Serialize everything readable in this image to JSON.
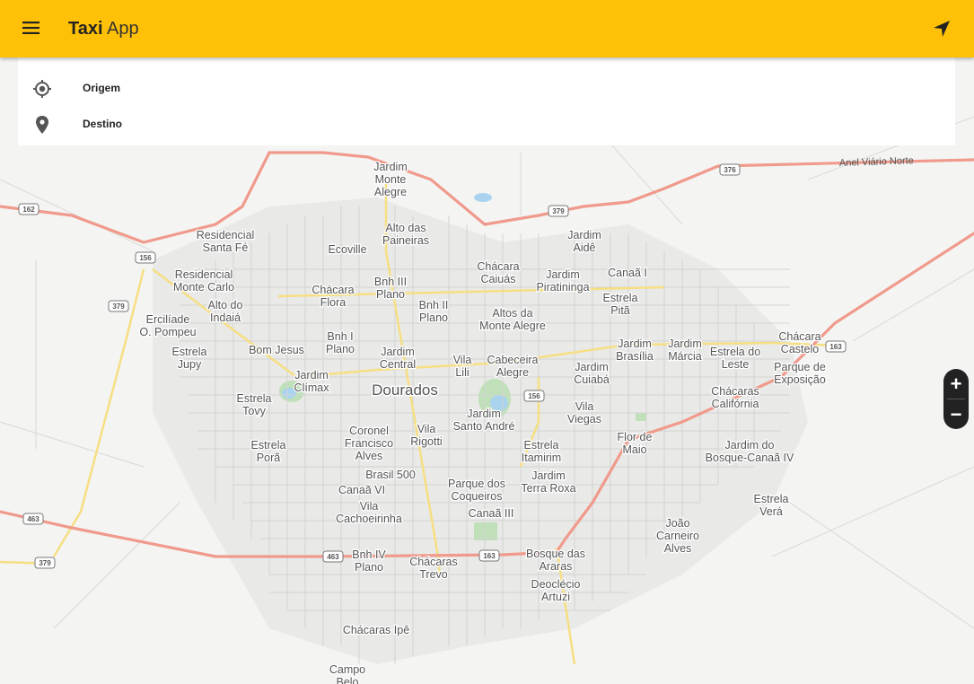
{
  "app": {
    "title_bold": "Taxi",
    "title_light": "App"
  },
  "icons": {
    "menu": "menu-icon",
    "navigate": "navigation-arrow-icon",
    "origin": "gps-crosshair-icon",
    "destination": "map-pin-icon"
  },
  "route": {
    "origin_label": "Origem",
    "destination_label": "Destino"
  },
  "zoom": {
    "in": "+",
    "out": "−"
  },
  "colors": {
    "appbar": "#ffc107",
    "major_road": "#f09a8c",
    "minor_road": "#f6df82"
  },
  "map_labels": {
    "city": "Dourados",
    "districts": [
      [
        "Jardim",
        "Monte",
        "Alegre"
      ],
      [
        "Alto das",
        "Paineiras"
      ],
      [
        "Ecoville"
      ],
      [
        "Residencial",
        "Santa Fé"
      ],
      [
        "Residencial",
        "Monte Carlo"
      ],
      [
        "Alto do",
        "Indaiá"
      ],
      [
        "Ercilíade",
        "O. Pompeu"
      ],
      [
        "Estrela",
        "Jupy"
      ],
      [
        "Chácara",
        "Flora"
      ],
      [
        "Bnh III",
        "Plano"
      ],
      [
        "Bnh II",
        "Plano"
      ],
      [
        "Chácara",
        "Caiuás"
      ],
      [
        "Jardim",
        "Aidê"
      ],
      [
        "Jardim",
        "Piratininga"
      ],
      [
        "Canaã I"
      ],
      [
        "Estrela",
        "Pitã"
      ],
      [
        "Altos da",
        "Monte Alegre"
      ],
      [
        "Bom Jesus"
      ],
      [
        "Bnh I",
        "Plano"
      ],
      [
        "Jardim",
        "Central"
      ],
      [
        "Vila",
        "Lili"
      ],
      [
        "Cabeceira",
        "Alegre"
      ],
      [
        "Jardim",
        "Brasília"
      ],
      [
        "Jardim",
        "Márcia"
      ],
      [
        "Estrela do",
        "Leste"
      ],
      [
        "Chácara",
        "Castelo"
      ],
      [
        "Parque de",
        "Exposição"
      ],
      [
        "Jardim",
        "Clímax"
      ],
      [
        "Estrela",
        "Tovy"
      ],
      [
        "Jardim",
        "Cuiabá"
      ],
      [
        "Chácaras",
        "Califórnia"
      ],
      [
        "Jardim",
        "Santo André"
      ],
      [
        "Vila",
        "Viegas"
      ],
      [
        "Coronel",
        "Francisco",
        "Alves"
      ],
      [
        "Vila",
        "Rigotti"
      ],
      [
        "Estrela",
        "Porã"
      ],
      [
        "Flor de",
        "Maio"
      ],
      [
        "Jardim do",
        "Bosque-Canaã IV"
      ],
      [
        "Estrela",
        "Itamirim"
      ],
      [
        "Brasil 500"
      ],
      [
        "Jardim",
        "Terra Roxa"
      ],
      [
        "Canaã VI"
      ],
      [
        "Parque dos",
        "Coqueiros"
      ],
      [
        "Vila",
        "Cachoeirinha"
      ],
      [
        "Canaã III"
      ],
      [
        "Estrela",
        "Verá"
      ],
      [
        "João",
        "Carneiro",
        "Alves"
      ],
      [
        "Bnh IV",
        "Plano"
      ],
      [
        "Chácaras",
        "Trevo"
      ],
      [
        "Bosque das",
        "Araras"
      ],
      [
        "Deoclécio",
        "Artuzi"
      ],
      [
        "Chácaras Ipê"
      ],
      [
        "Campo",
        "Belo"
      ]
    ],
    "road_name": "Anel Viário Norte",
    "shields": [
      "376",
      "379",
      "162",
      "156",
      "379",
      "163",
      "156",
      "463",
      "379",
      "463",
      "163"
    ]
  }
}
